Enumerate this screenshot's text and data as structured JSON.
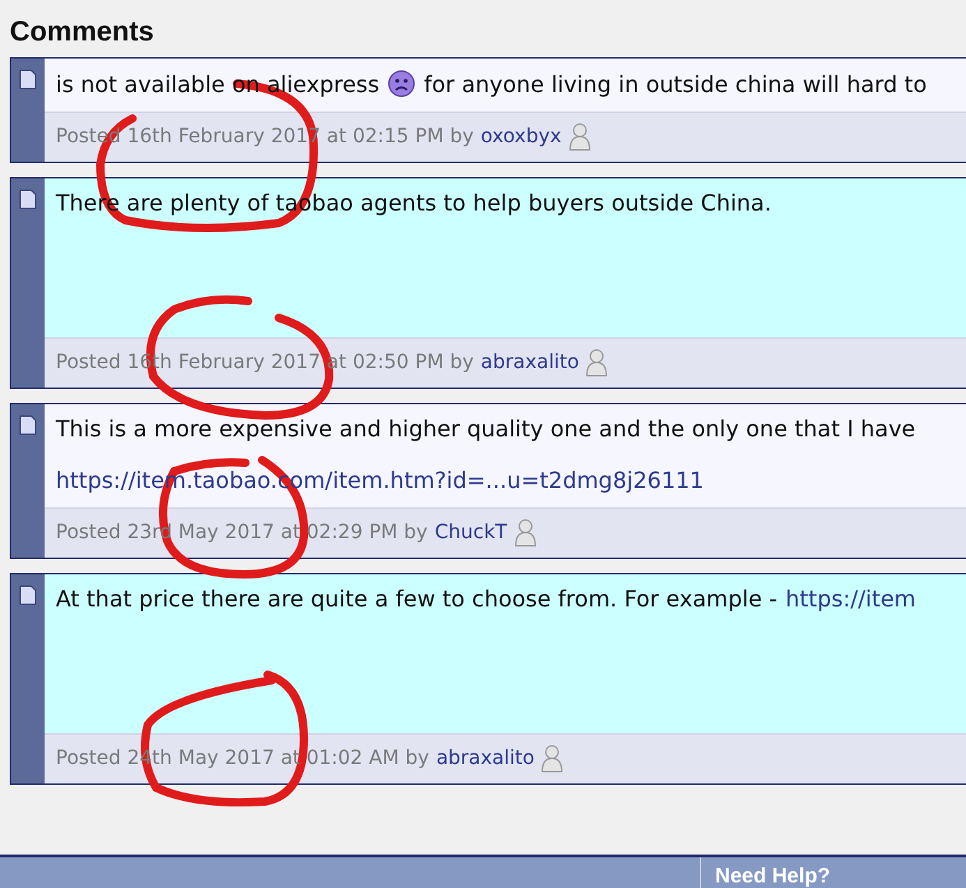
{
  "heading": "Comments",
  "comments": [
    {
      "highlighted": false,
      "lines": [
        [
          {
            "kind": "text",
            "text": "is not available on aliexpress"
          },
          {
            "kind": "emoji"
          },
          {
            "kind": "text",
            "text": "for anyone living in outside china will hard to"
          }
        ]
      ],
      "posted": "Posted 16th February 2017 at 02:15 PM by",
      "author": "oxoxbyx"
    },
    {
      "highlighted": true,
      "lines": [
        [
          {
            "kind": "text",
            "text": "There are plenty of taobao agents to help buyers outside China."
          }
        ]
      ],
      "posted": "Posted 16th February 2017 at 02:50 PM by",
      "author": "abraxalito"
    },
    {
      "highlighted": false,
      "lines": [
        [
          {
            "kind": "text",
            "text": "This is a more expensive and higher quality one and the only one that I have"
          }
        ],
        [
          {
            "kind": "link",
            "text": "https://item.taobao.com/item.htm?id=...u=t2dmg8j26111"
          }
        ]
      ],
      "posted": "Posted 23rd May 2017 at 02:29 PM by",
      "author": "ChuckT"
    },
    {
      "highlighted": true,
      "lines": [
        [
          {
            "kind": "text",
            "text": "At that price there are quite a few to choose from. For example -"
          },
          {
            "kind": "link",
            "text": "https://item"
          }
        ]
      ],
      "posted": "Posted 24th May 2017 at 01:02 AM by",
      "author": "abraxalito"
    }
  ],
  "footer": {
    "title": "Need Help?"
  }
}
